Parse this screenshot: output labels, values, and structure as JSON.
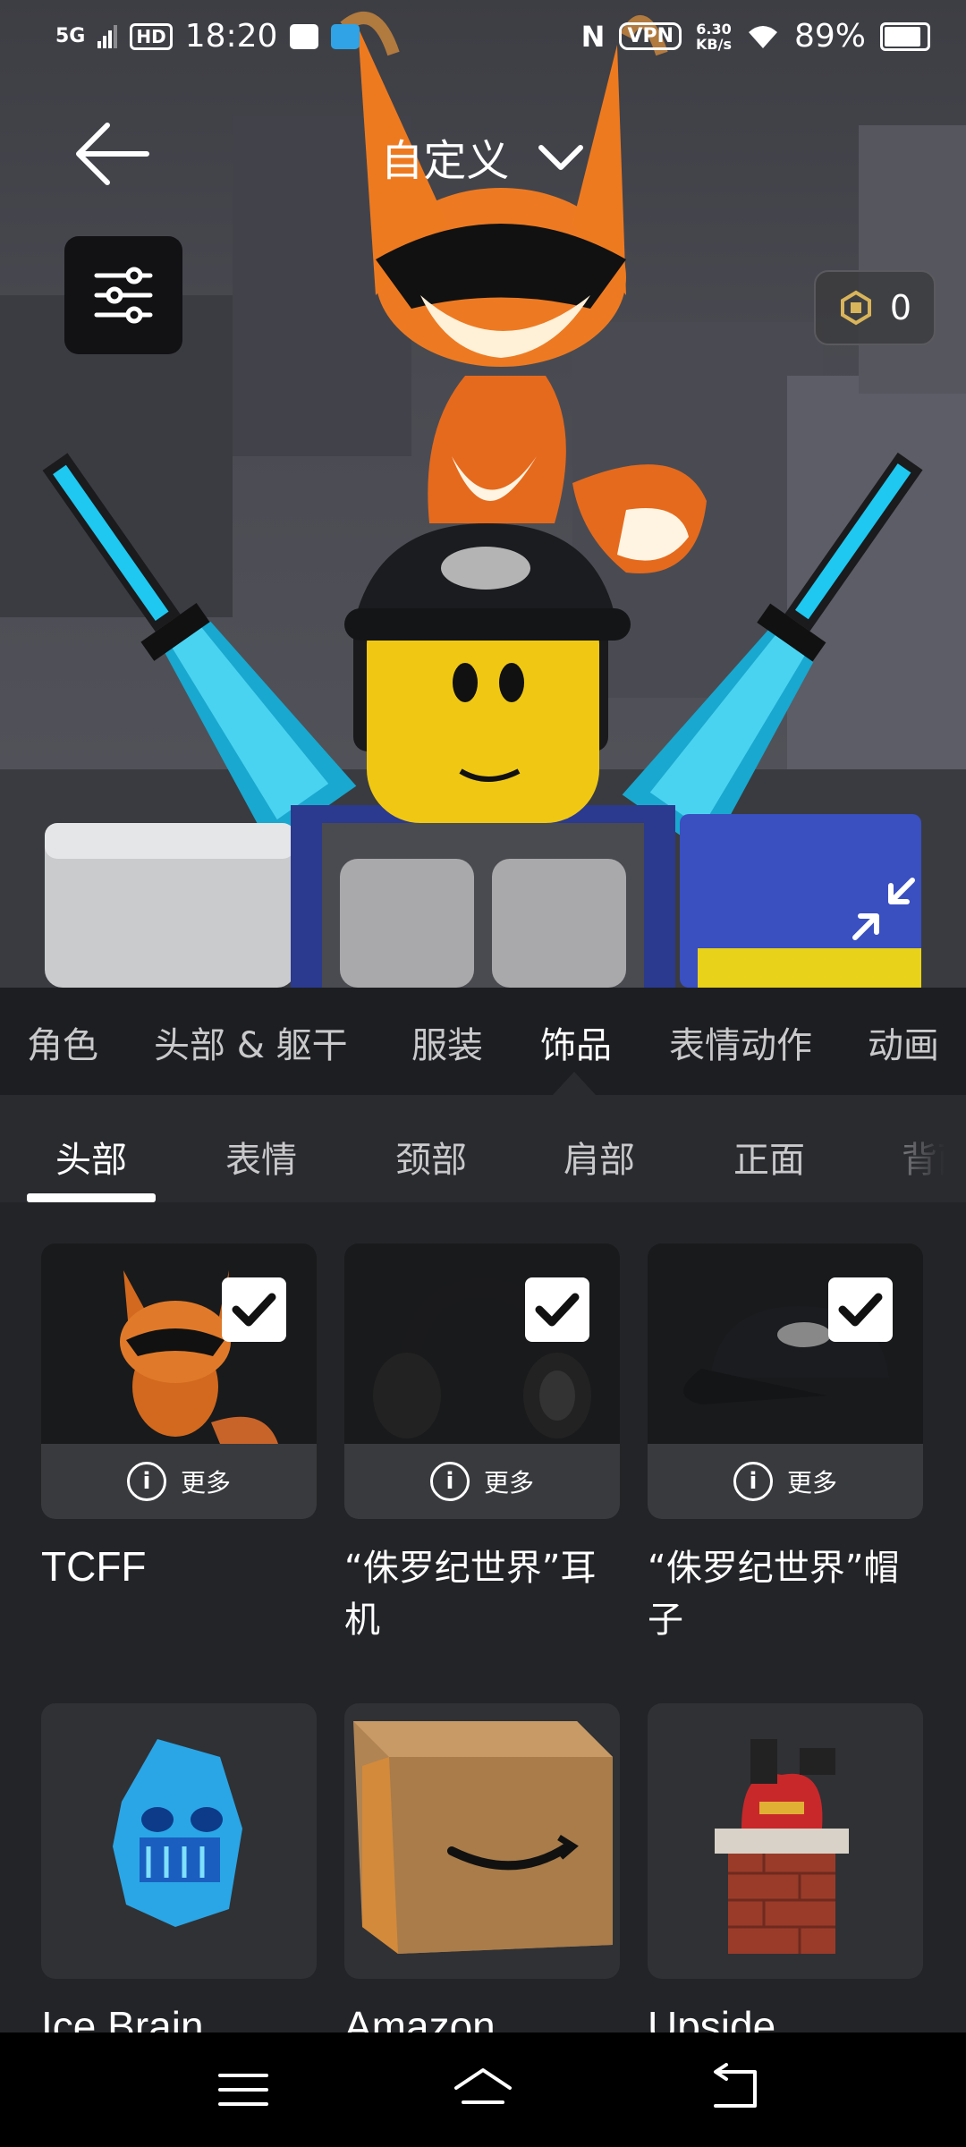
{
  "status_bar": {
    "network": "5G",
    "hd": "HD",
    "time": "18:20",
    "vpn": "VPN",
    "speed_value": "6.30",
    "speed_unit": "KB/s",
    "battery": "89%"
  },
  "header": {
    "title": "自定义",
    "robux_count": "0"
  },
  "category_tabs": [
    {
      "label": "角色",
      "active": false
    },
    {
      "label": "头部 & 躯干",
      "active": false
    },
    {
      "label": "服装",
      "active": false
    },
    {
      "label": "饰品",
      "active": true
    },
    {
      "label": "表情动作",
      "active": false
    },
    {
      "label": "动画",
      "active": false
    }
  ],
  "sub_tabs": [
    {
      "label": "头部",
      "active": true
    },
    {
      "label": "表情",
      "active": false
    },
    {
      "label": "颈部",
      "active": false
    },
    {
      "label": "肩部",
      "active": false
    },
    {
      "label": "正面",
      "active": false
    },
    {
      "label": "背面",
      "active": false
    }
  ],
  "items": [
    {
      "name": "TCFF",
      "selected": true,
      "more_label": "更多",
      "icon": "fox-accessory-icon"
    },
    {
      "name": "“侏罗纪世界”耳机",
      "selected": true,
      "more_label": "更多",
      "icon": "headphones-icon"
    },
    {
      "name": "“侏罗纪世界”帽子",
      "selected": true,
      "more_label": "更多",
      "icon": "cap-icon"
    },
    {
      "name": "Ice Brain",
      "selected": false,
      "icon": "ice-brain-icon"
    },
    {
      "name": "Amazon",
      "selected": false,
      "icon": "amazon-box-icon"
    },
    {
      "name": "Upside",
      "selected": false,
      "icon": "chimney-santa-icon"
    }
  ],
  "colors": {
    "accent": "#1ec8f0",
    "background": "#232427",
    "tab_bar": "#1d1e21",
    "sub_tab_bar": "#2a2b2f"
  }
}
